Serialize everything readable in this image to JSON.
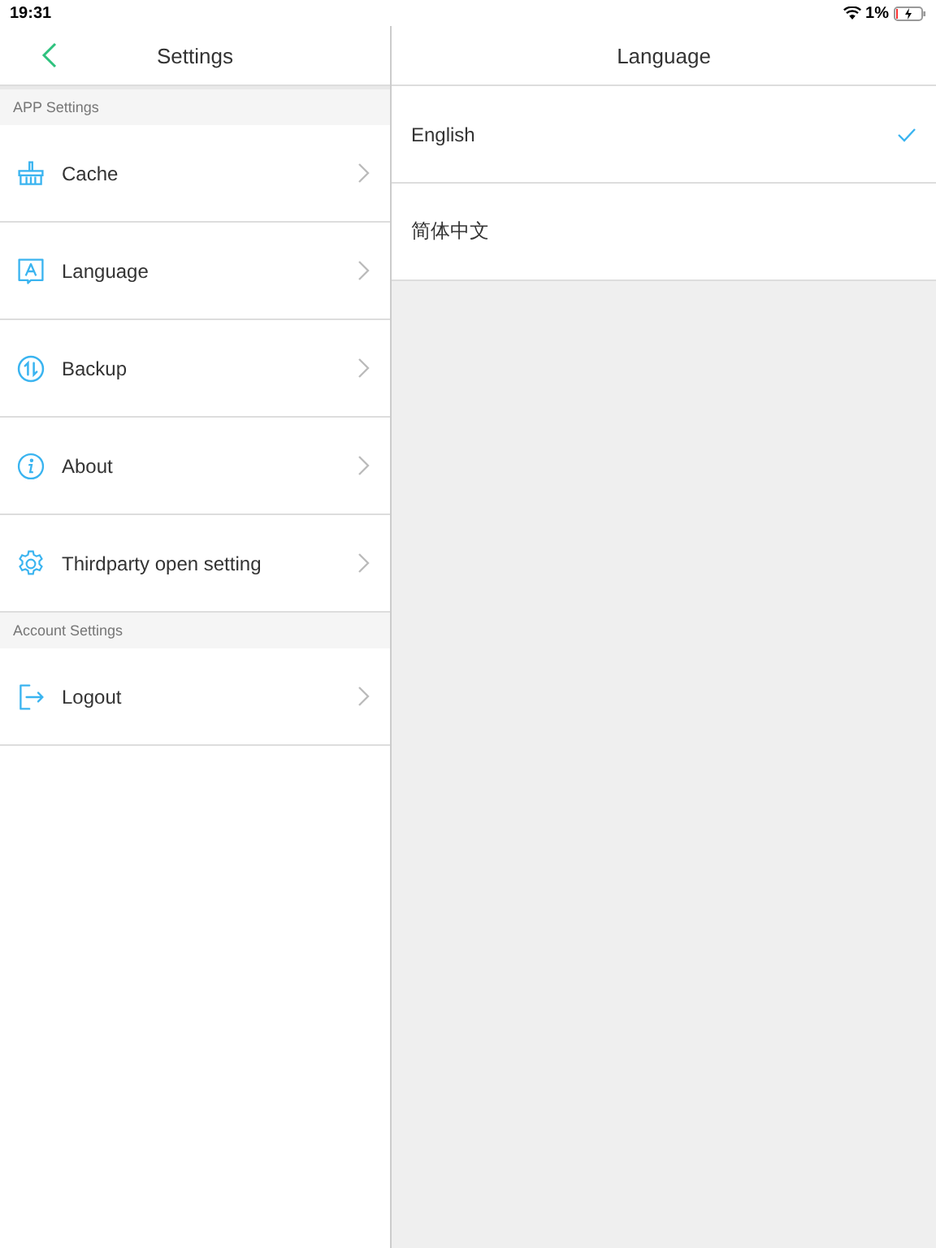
{
  "status_bar": {
    "time": "19:31",
    "battery": "1%"
  },
  "settings": {
    "title": "Settings",
    "sections": [
      {
        "title": "APP Settings",
        "items": [
          {
            "label": "Cache",
            "kind": "cache"
          },
          {
            "label": "Language",
            "kind": "language"
          },
          {
            "label": "Backup",
            "kind": "backup"
          },
          {
            "label": "About",
            "kind": "about"
          },
          {
            "label": "Thirdparty open setting",
            "kind": "gear"
          }
        ]
      },
      {
        "title": "Account Settings",
        "items": [
          {
            "label": "Logout",
            "kind": "logout"
          }
        ]
      }
    ]
  },
  "language": {
    "title": "Language",
    "options": [
      {
        "label": "English",
        "selected": true
      },
      {
        "label": "简体中文",
        "selected": false
      }
    ]
  }
}
